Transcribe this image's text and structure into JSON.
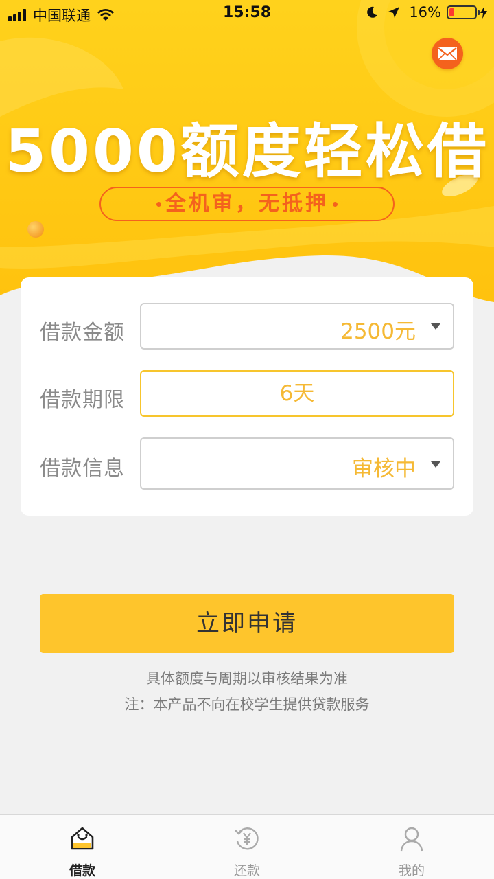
{
  "status_bar": {
    "carrier": "中国联通",
    "time": "15:58",
    "battery": "16%"
  },
  "banner": {
    "headline": "5000额度轻松借",
    "subtitle": "全机审，无抵押"
  },
  "form": {
    "amount": {
      "label": "借款金额",
      "value": "2500元"
    },
    "term": {
      "label": "借款期限",
      "value": "6天"
    },
    "info": {
      "label": "借款信息",
      "value": "审核中"
    }
  },
  "apply_button": "立即申请",
  "notes": {
    "line1": "具体额度与周期以审核结果为准",
    "line2": "注：本产品不向在校学生提供贷款服务"
  },
  "tabs": [
    {
      "label": "借款",
      "icon": "home-smile-icon",
      "active": true
    },
    {
      "label": "还款",
      "icon": "repay-yen-icon",
      "active": false
    },
    {
      "label": "我的",
      "icon": "user-icon",
      "active": false
    }
  ],
  "colors": {
    "accent_yellow": "#fec52c",
    "orange": "#f4621d",
    "value_text": "#f5b935"
  }
}
